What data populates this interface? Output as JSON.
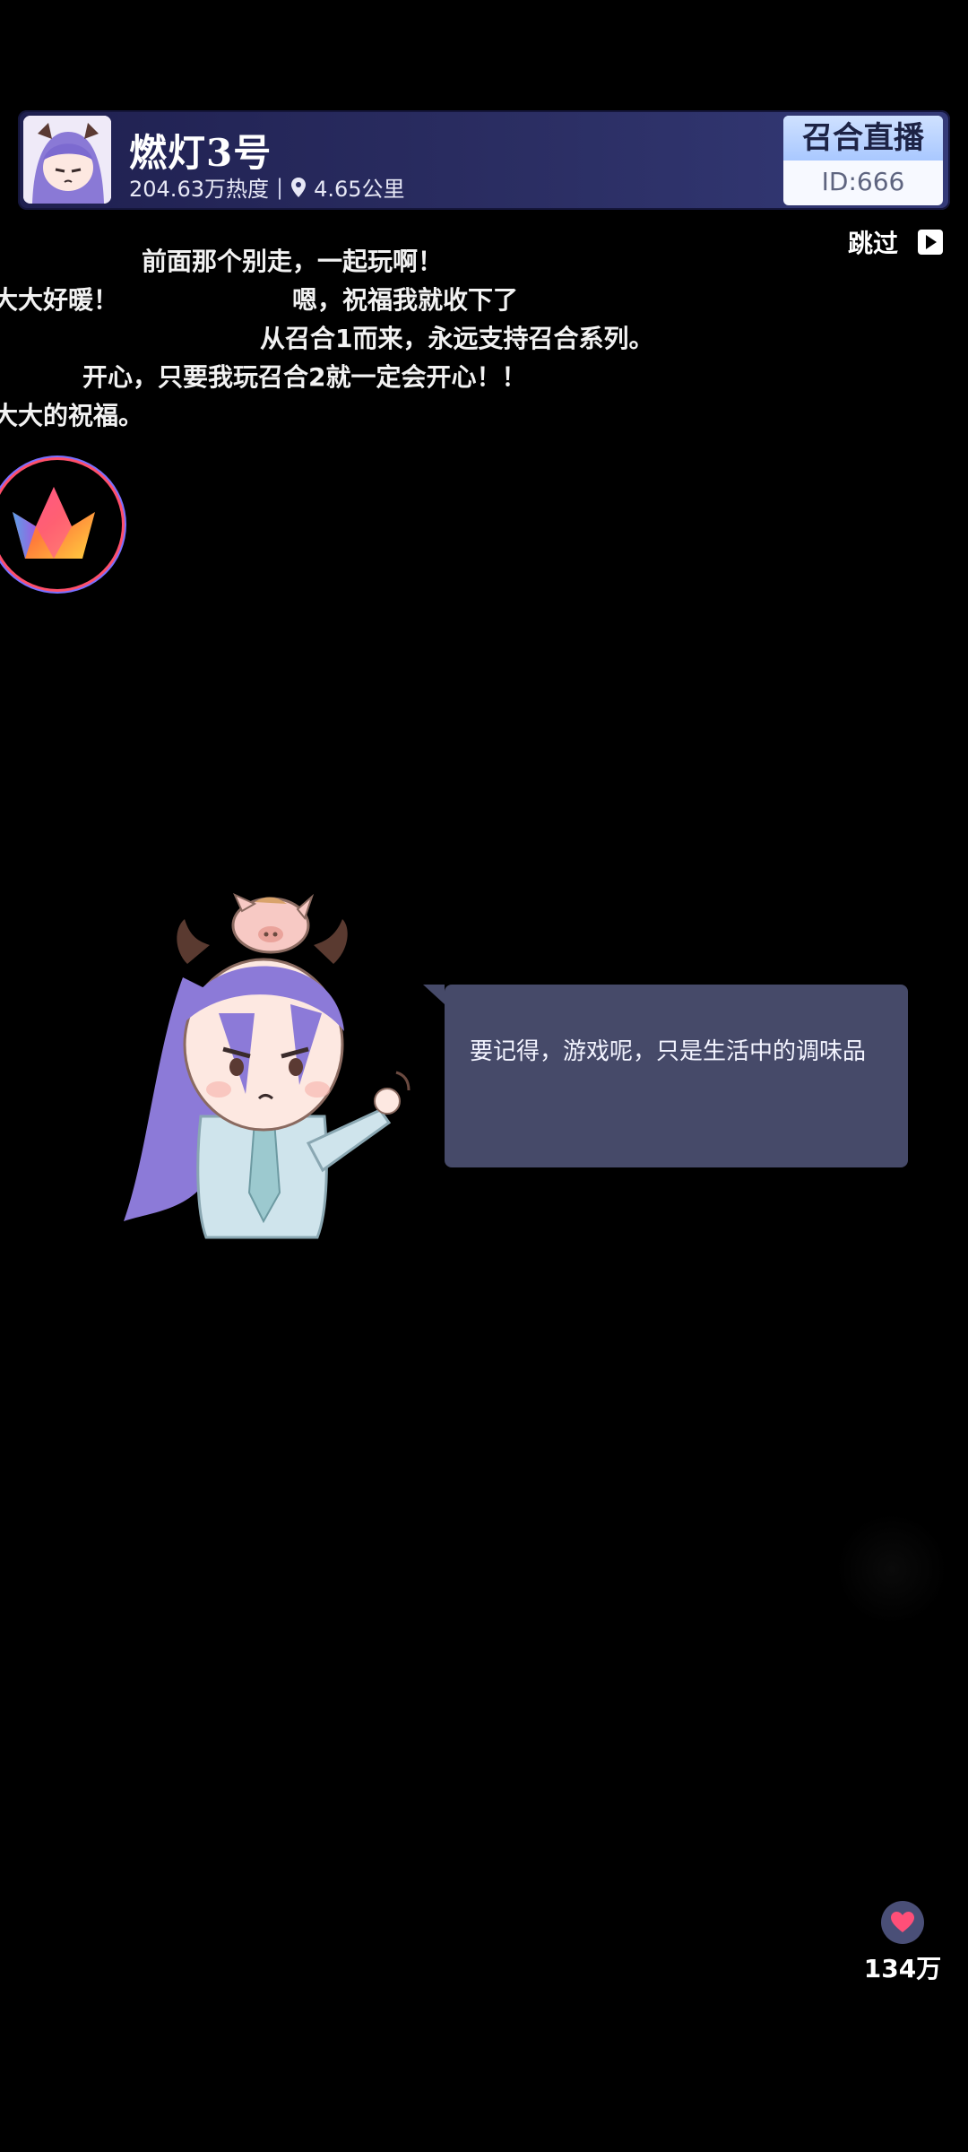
{
  "header": {
    "name": "燃灯3号",
    "heat": "204.63万热度",
    "separator": "|",
    "distance": "4.65公里",
    "brand_title": "召合直播",
    "id_text": "ID:666"
  },
  "skip_label": "跳过",
  "danmaku": [
    "前面那个别走，一起玩啊！",
    "大大好暖！",
    "嗯，祝福我就收下了",
    "从召合1而来，永远支持召合系列。",
    "开心，只要我玩召合2就一定会开心！！",
    "大大的祝福。"
  ],
  "speech": "要记得，游戏呢，只是生活中的调味品",
  "like_count": "134万",
  "colors": {
    "bubble": "#464a69",
    "header_from": "#1f2050",
    "header_to": "#343a78",
    "like_heart": "#ff4f78"
  }
}
